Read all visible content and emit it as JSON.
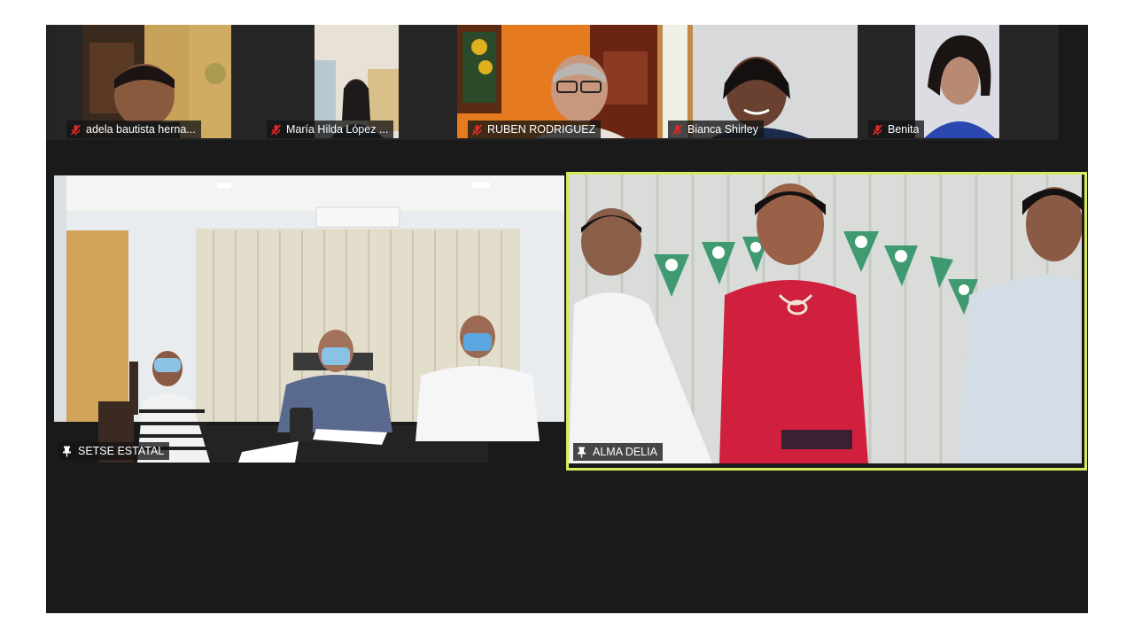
{
  "meeting": {
    "thumbnails": [
      {
        "name": "adela bautista herna...",
        "muted": true
      },
      {
        "name": "María Hilda López ...",
        "muted": true
      },
      {
        "name": "RUBEN RODRIGUEZ",
        "muted": true
      },
      {
        "name": "Bianca Shirley",
        "muted": true
      },
      {
        "name": "Benita",
        "muted": true
      }
    ],
    "main_videos": [
      {
        "name": "SETSE ESTATAL",
        "pinned": true
      },
      {
        "name": "ALMA DELIA",
        "pinned": true,
        "active_speaker": true
      }
    ],
    "colors": {
      "active_speaker_border": "#d6ea5e",
      "mute_icon": "#e02828",
      "background": "#1a1a1a"
    }
  }
}
